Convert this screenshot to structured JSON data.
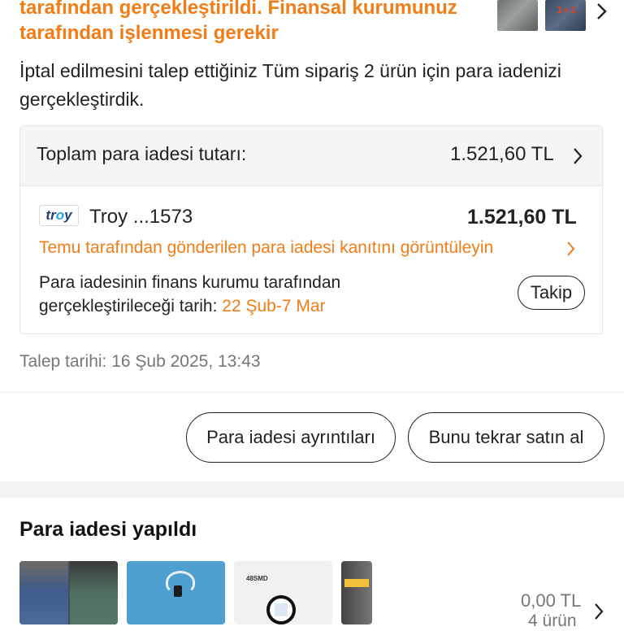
{
  "notice": {
    "title": "tarafından gerçekleştirildi. Finansal kurumunuz tarafından işlenmesi gerekir",
    "description": "İptal edilmesini talep ettiğiniz Tüm sipariş 2 ürün için para iadenizi gerçekleştirdik.",
    "thumb_badge": "1+1"
  },
  "refund_card": {
    "total_label": "Toplam para iadesi tutarı:",
    "total_value": "1.521,60 TL",
    "payment_logo": "troy",
    "payment_name": "Troy ...1573",
    "payment_amount": "1.521,60 TL",
    "proof_link": "Temu tarafından gönderilen para iadesi kanıtını görüntüleyin",
    "bank_text": "Para iadesinin finans kurumu tarafından gerçekleştirileceği tarih: ",
    "bank_date": "22 Şub-7 Mar",
    "follow_button": "Takip"
  },
  "request_date": "Talep tarihi: 16 Şub 2025, 13:43",
  "actions": {
    "details_button": "Para iadesi ayrıntıları",
    "rebuy_button": "Bunu tekrar satın al"
  },
  "refunded_section": {
    "title": "Para iadesi yapıldı",
    "product_3_label": "48SMD",
    "summary_price": "0,00 TL",
    "summary_count": "4 ürün"
  },
  "colors": {
    "accent": "#f27d16",
    "text": "#222222",
    "muted": "#777777"
  },
  "icons": [
    "chevron-right-icon",
    "troy-card-icon"
  ]
}
